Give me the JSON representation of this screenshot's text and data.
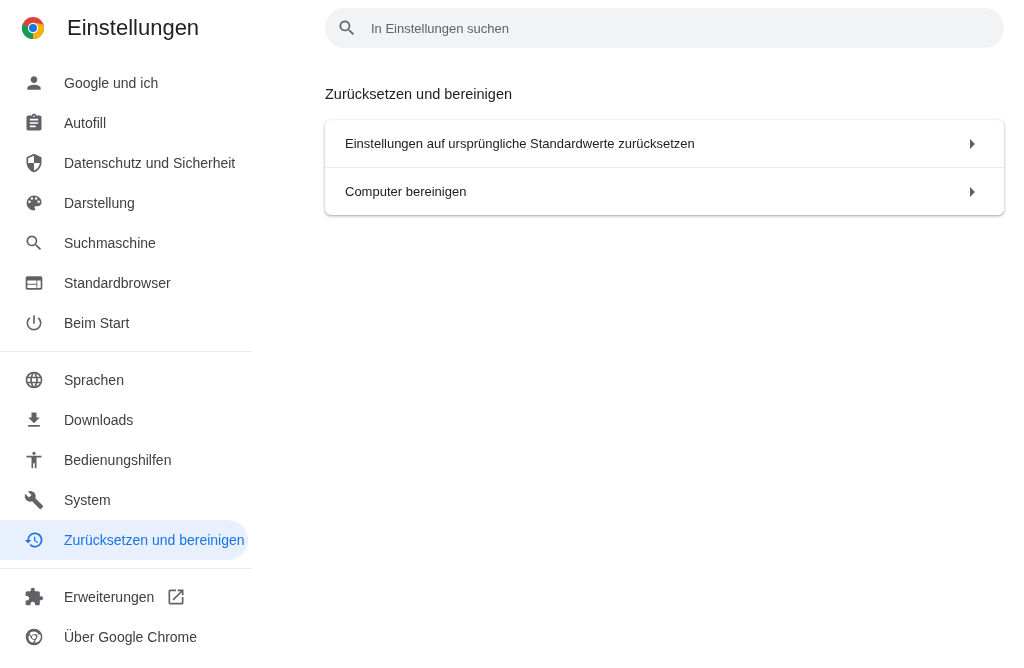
{
  "header": {
    "title": "Einstellungen"
  },
  "search": {
    "placeholder": "In Einstellungen suchen"
  },
  "sidebar": {
    "groups": [
      [
        {
          "label": "Google und ich",
          "selected": false
        },
        {
          "label": "Autofill",
          "selected": false
        },
        {
          "label": "Datenschutz und Sicherheit",
          "selected": false
        },
        {
          "label": "Darstellung",
          "selected": false
        },
        {
          "label": "Suchmaschine",
          "selected": false
        },
        {
          "label": "Standardbrowser",
          "selected": false
        },
        {
          "label": "Beim Start",
          "selected": false
        }
      ],
      [
        {
          "label": "Sprachen",
          "selected": false
        },
        {
          "label": "Downloads",
          "selected": false
        },
        {
          "label": "Bedienungshilfen",
          "selected": false
        },
        {
          "label": "System",
          "selected": false
        },
        {
          "label": "Zurücksetzen und bereinigen",
          "selected": true
        }
      ],
      [
        {
          "label": "Erweiterungen",
          "selected": false
        },
        {
          "label": "Über Google Chrome",
          "selected": false
        }
      ]
    ]
  },
  "section": {
    "title": "Zurücksetzen und bereinigen",
    "rows": [
      {
        "label": "Einstellungen auf ursprüngliche Standardwerte zurücksetzen"
      },
      {
        "label": "Computer bereinigen"
      }
    ]
  }
}
